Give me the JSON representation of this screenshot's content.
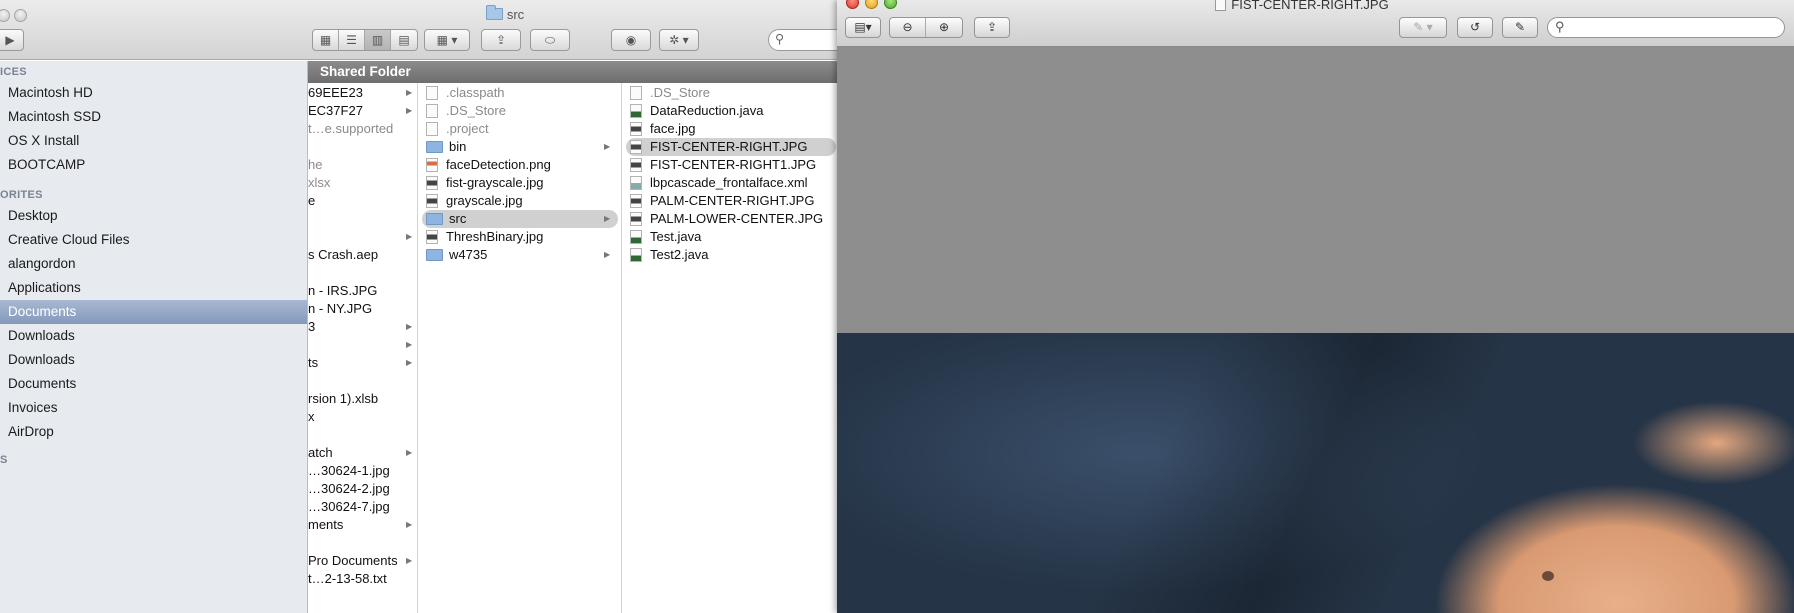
{
  "finder": {
    "title": "src",
    "column_header": "Shared Folder",
    "sidebar": {
      "sections": [
        {
          "label": "ICES",
          "top": 0
        },
        {
          "label": "ORITES",
          "top": 0
        },
        {
          "label": "S",
          "top": 0
        }
      ],
      "devices": [
        "Macintosh HD",
        "Macintosh SSD",
        "OS X Install",
        "BOOTCAMP"
      ],
      "favorites": [
        "Desktop",
        "Creative Cloud Files",
        "alangordon",
        "Applications",
        "Documents",
        "Downloads",
        "Downloads",
        "Documents",
        "Invoices",
        "AirDrop"
      ],
      "selected": "Documents"
    },
    "column1": [
      {
        "text": "69EEE23",
        "arrow": true
      },
      {
        "text": "EC37F27",
        "arrow": true
      },
      {
        "text": "t…e.supported",
        "arrow": false,
        "dim": true
      },
      {
        "text": "",
        "arrow": false
      },
      {
        "text": "he",
        "arrow": false,
        "dim": true
      },
      {
        "text": "xlsx",
        "arrow": false,
        "dim": true
      },
      {
        "text": "e",
        "arrow": false
      },
      {
        "text": "",
        "arrow": false
      },
      {
        "text": "",
        "arrow": true
      },
      {
        "text": "s Crash.aep",
        "arrow": false
      },
      {
        "text": "",
        "arrow": false
      },
      {
        "text": "n - IRS.JPG",
        "arrow": false
      },
      {
        "text": "n - NY.JPG",
        "arrow": false
      },
      {
        "text": "3",
        "arrow": true
      },
      {
        "text": "",
        "arrow": true
      },
      {
        "text": "ts",
        "arrow": true
      },
      {
        "text": "",
        "arrow": false
      },
      {
        "text": "rsion 1).xlsb",
        "arrow": false
      },
      {
        "text": "x",
        "arrow": false
      },
      {
        "text": "",
        "arrow": false
      },
      {
        "text": "atch",
        "arrow": true
      },
      {
        "text": "…30624-1.jpg",
        "arrow": false
      },
      {
        "text": "…30624-2.jpg",
        "arrow": false
      },
      {
        "text": "…30624-7.jpg",
        "arrow": false
      },
      {
        "text": "ments",
        "arrow": true
      },
      {
        "text": "",
        "arrow": false
      },
      {
        "text": " Pro Documents",
        "arrow": true
      },
      {
        "text": "t…2-13-58.txt",
        "arrow": false
      }
    ],
    "column2": [
      {
        "name": ".classpath",
        "kind": "file",
        "dim": true
      },
      {
        "name": ".DS_Store",
        "kind": "file",
        "dim": true
      },
      {
        "name": ".project",
        "kind": "file",
        "dim": true
      },
      {
        "name": "bin",
        "kind": "folder",
        "arrow": true
      },
      {
        "name": "faceDetection.png",
        "kind": "png"
      },
      {
        "name": "fist-grayscale.jpg",
        "kind": "img"
      },
      {
        "name": "grayscale.jpg",
        "kind": "img"
      },
      {
        "name": "src",
        "kind": "folder",
        "arrow": true,
        "selected": true
      },
      {
        "name": "ThreshBinary.jpg",
        "kind": "img"
      },
      {
        "name": "w4735",
        "kind": "folder",
        "arrow": true
      }
    ],
    "column3": [
      {
        "name": ".DS_Store",
        "kind": "file",
        "dim": true
      },
      {
        "name": "DataReduction.java",
        "kind": "dw"
      },
      {
        "name": "face.jpg",
        "kind": "img"
      },
      {
        "name": "FIST-CENTER-RIGHT.JPG",
        "kind": "img",
        "selected": true
      },
      {
        "name": "FIST-CENTER-RIGHT1.JPG",
        "kind": "img"
      },
      {
        "name": "lbpcascade_frontalface.xml",
        "kind": "xml"
      },
      {
        "name": "PALM-CENTER-RIGHT.JPG",
        "kind": "img"
      },
      {
        "name": "PALM-LOWER-CENTER.JPG",
        "kind": "img"
      },
      {
        "name": "Test.java",
        "kind": "dw"
      },
      {
        "name": "Test2.java",
        "kind": "dw"
      }
    ]
  },
  "preview": {
    "title": "FIST-CENTER-RIGHT.JPG",
    "search_placeholder": "",
    "image_description_name": "fist-photo"
  },
  "icons": {
    "back": "triangle-back-icon",
    "views": [
      "icon-view-icon",
      "list-view-icon",
      "column-view-icon",
      "coverflow-view-icon"
    ],
    "arrange": "arrange-icon",
    "share": "share-icon",
    "tag": "tag-icon",
    "quicklook": "eye-icon",
    "action": "gear-icon",
    "search": "search-icon"
  },
  "colors": {
    "sidebar_bg": "#e7ebf0",
    "selection": "#8499bb",
    "column_header": "#7d7d7d",
    "preview_bg": "#8e8e8e"
  }
}
